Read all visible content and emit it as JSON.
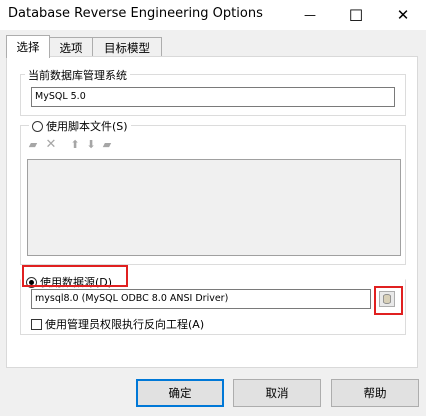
{
  "window": {
    "title": "Database Reverse Engineering Options",
    "minimize_glyph": "—",
    "maximize_glyph": "☐",
    "close_glyph": "✕"
  },
  "tabs": [
    {
      "label": "选择",
      "active": true
    },
    {
      "label": "选项",
      "active": false
    },
    {
      "label": "目标模型",
      "active": false
    }
  ],
  "dbms_group": {
    "label": "当前数据库管理系统",
    "value": "MySQL 5.0"
  },
  "script_option": {
    "label": "使用脚本文件(S)",
    "selected": false,
    "toolbar_icons": [
      "add-file-icon",
      "delete-icon",
      "move-up-icon",
      "move-down-icon",
      "file-icon"
    ]
  },
  "datasource_option": {
    "label": "使用数据源(D)",
    "selected": true,
    "value": "mysql8.0 (MySQL ODBC 8.0 ANSI Driver)",
    "browse_icon": "database-icon"
  },
  "admin_checkbox": {
    "label": "使用管理员权限执行反向工程(A)",
    "checked": false
  },
  "buttons": {
    "ok": "确定",
    "cancel": "取消",
    "help": "帮助"
  },
  "highlight_color": "#e02020"
}
